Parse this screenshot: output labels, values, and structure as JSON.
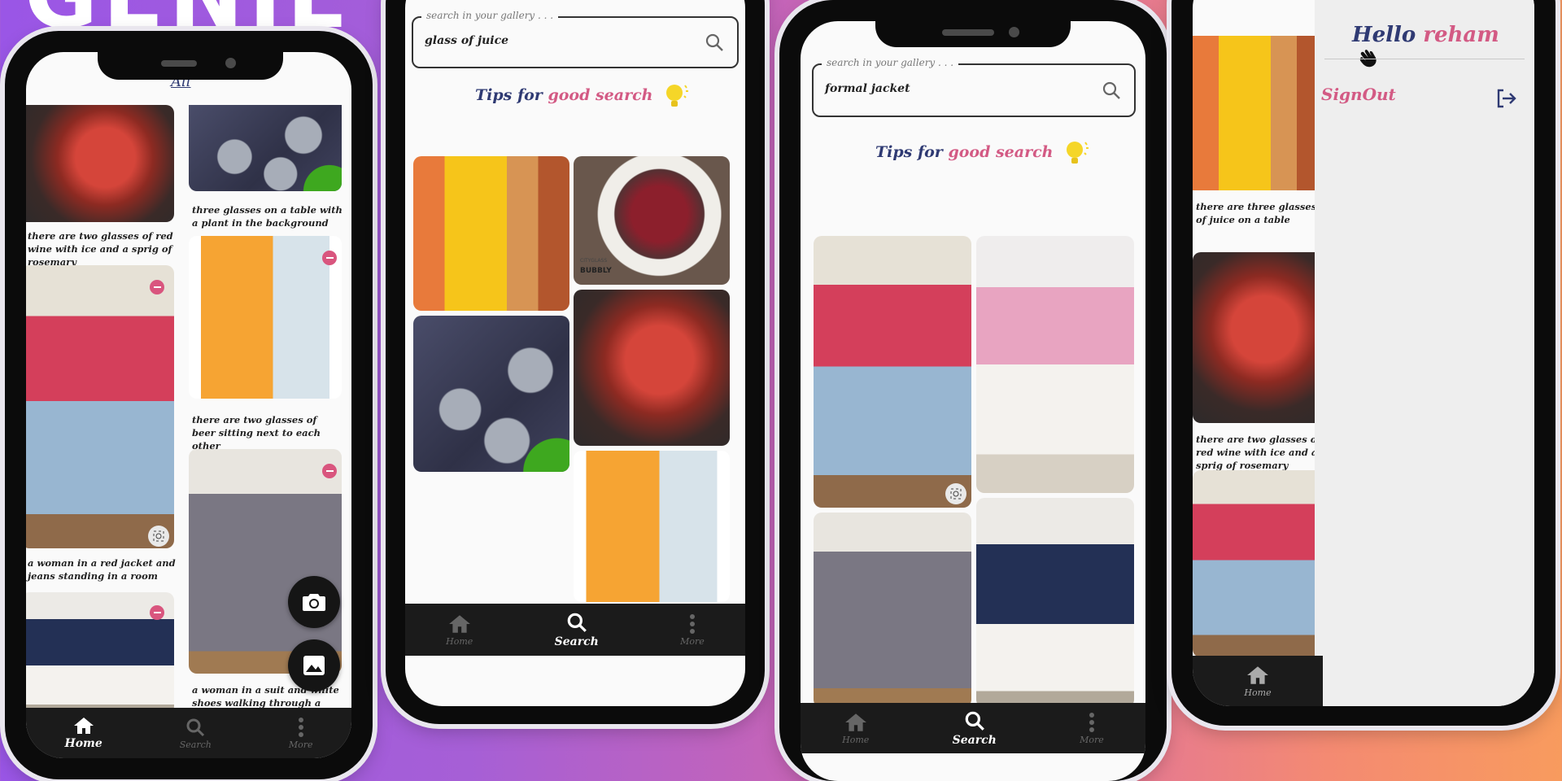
{
  "brand": {
    "title": "GENIE"
  },
  "nav": {
    "home": "Home",
    "search": "Search",
    "more": "More"
  },
  "colors": {
    "navy": "#2f3a73",
    "pink": "#d35a84",
    "navbar": "#1b1b1b",
    "minus_badge": "#d9557e"
  },
  "phone1": {
    "tab_all": "All",
    "captions": {
      "red_wine": "there are two glasses of red wine with ice and a sprig of rosemary",
      "three_glasses": "three glasses on a table with a plant in the background",
      "beer": "there are two glasses of beer sitting next to each other",
      "red_jacket": "a woman in a red jacket and jeans standing in a room",
      "suit": "a woman in a suit and white shoes walking through a doorway"
    },
    "fab_icons": [
      "camera-icon",
      "image-icon"
    ]
  },
  "phone2": {
    "search_legend": "search in your gallery . . .",
    "search_value": "glass of juice",
    "tips_part1": "Tips for ",
    "tips_part2": "good search",
    "brand_label": "BUBBLY",
    "brand_label2": "CITYGLASS"
  },
  "phone3": {
    "search_legend": "search in your gallery . . .",
    "search_value": "formal jacket",
    "tips_part1": "Tips for ",
    "tips_part2": "good search"
  },
  "phone4": {
    "greeting_part1": "Hello ",
    "greeting_part2": "reham",
    "signout": "SignOut",
    "captions": {
      "juice": "there are three glasses of juice on a table",
      "red_wine": "there are two glasses of red wine with ice and a sprig of rosemary"
    }
  }
}
